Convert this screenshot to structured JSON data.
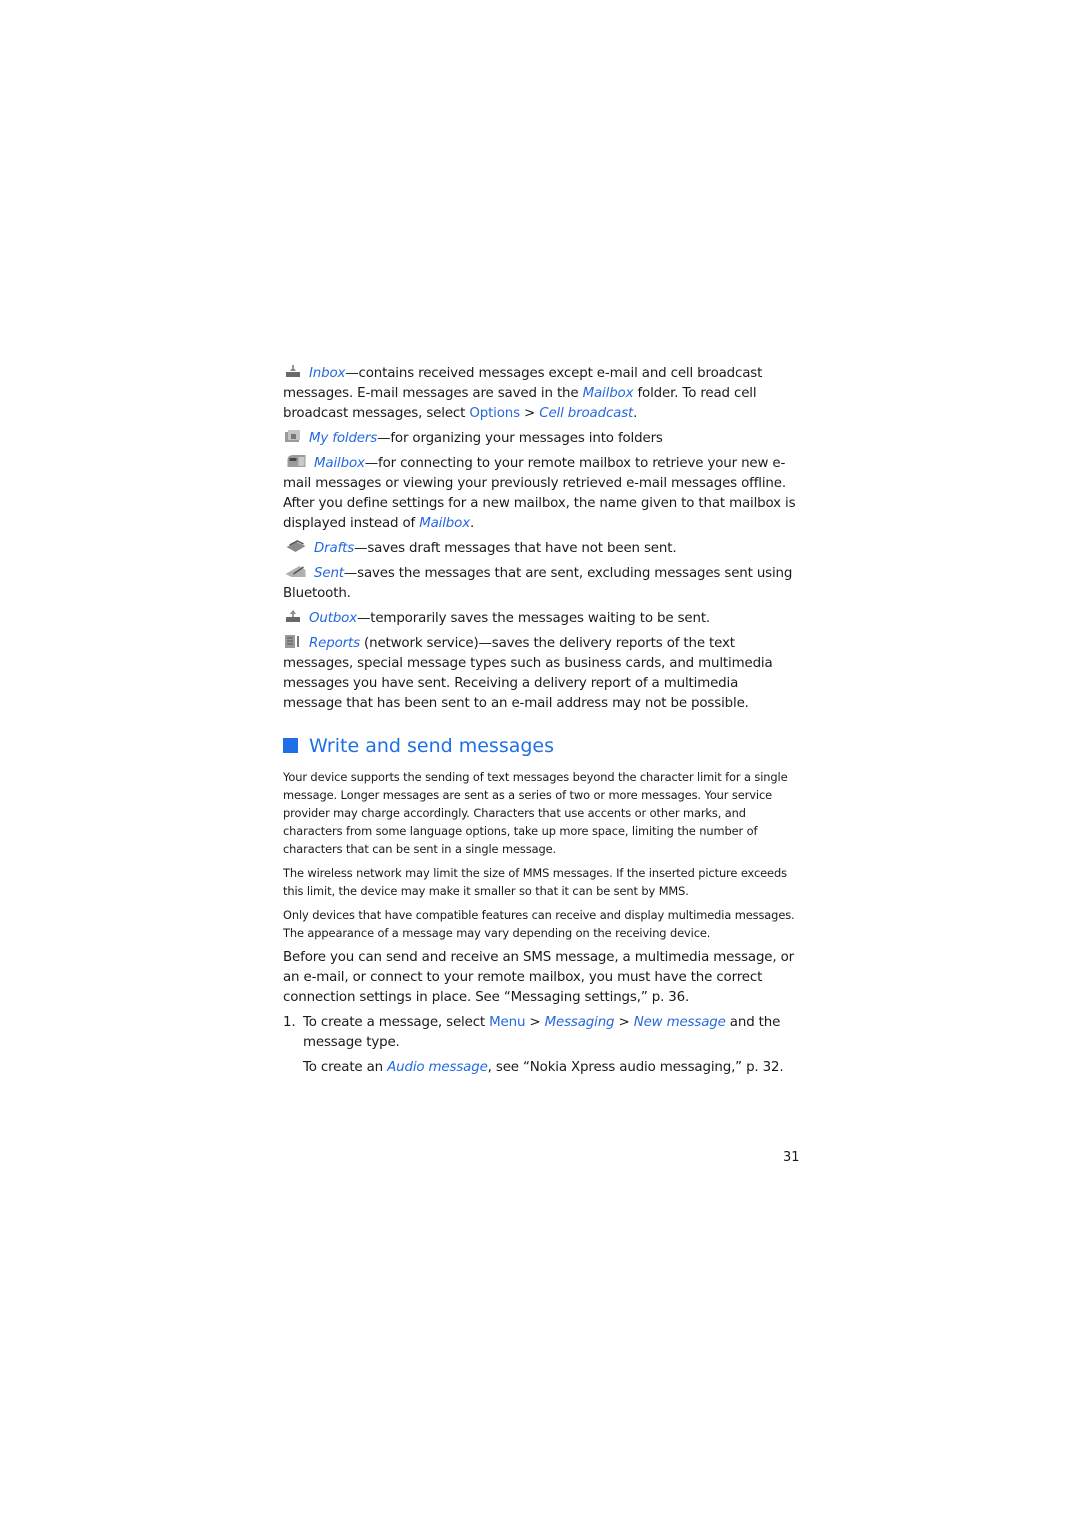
{
  "folders": [
    {
      "icon": "inbox-icon",
      "name": "Inbox",
      "rest": "—contains received messages except e-mail and cell broadcast messages. E-mail messages are saved in the ",
      "link2": "Mailbox",
      "rest2": " folder. To read cell broadcast messages, select ",
      "menu": "Options",
      "sep": " > ",
      "link3": "Cell broadcast",
      "end": "."
    },
    {
      "icon": "my-folders-icon",
      "name": "My folders",
      "rest": "—for organizing your messages into folders"
    },
    {
      "icon": "mailbox-icon",
      "name": "Mailbox",
      "rest": "—for connecting to your remote mailbox to retrieve your new e-mail messages or viewing your previously retrieved e-mail messages offline. After you define settings for a new mailbox, the name given to that mailbox is displayed instead of ",
      "link2": "Mailbox",
      "end": "."
    },
    {
      "icon": "drafts-icon",
      "name": "Drafts",
      "rest": "—saves draft messages that have not been sent."
    },
    {
      "icon": "sent-icon",
      "name": "Sent",
      "rest": "—saves the messages that are sent, excluding messages sent using Bluetooth."
    },
    {
      "icon": "outbox-icon",
      "name": "Outbox",
      "rest": "—temporarily saves the messages waiting to be sent."
    },
    {
      "icon": "reports-icon",
      "name": "Reports",
      "rest": " (network service)—saves the delivery reports of the text messages, special message types such as business cards, and multimedia messages you have sent. Receiving a delivery report of a multimedia message that has been sent to an e-mail address may not be possible."
    }
  ],
  "section": {
    "title": "Write and send messages",
    "notes": [
      "Your device supports the sending of text messages beyond the character limit for a single message. Longer messages are sent as a series of two or more messages. Your service provider may charge accordingly. Characters that use accents or other marks, and characters from some language options, take up more space, limiting the number of characters that can be sent in a single message.",
      "The wireless network may limit the size of MMS messages. If the inserted picture exceeds this limit, the device may make it smaller so that it can be sent by MMS.",
      "Only devices that have compatible features can receive and display multimedia messages. The appearance of a message may vary depending on the receiving device."
    ],
    "body": "Before you can send and receive an SMS message, a multimedia message, or an e-mail, or connect to your remote mailbox, you must have the correct connection settings in place. See “Messaging settings,” p. 36.",
    "step1": {
      "num": "1.",
      "pre": "To create a message, select ",
      "menu": "Menu",
      "sep": " > ",
      "link1": "Messaging",
      "link2": "New message",
      "post": " and the message type."
    },
    "step1_note": {
      "pre": "To create an ",
      "link": "Audio message",
      "post": ", see “Nokia Xpress audio messaging,” p. 32."
    }
  },
  "page_number": "31"
}
